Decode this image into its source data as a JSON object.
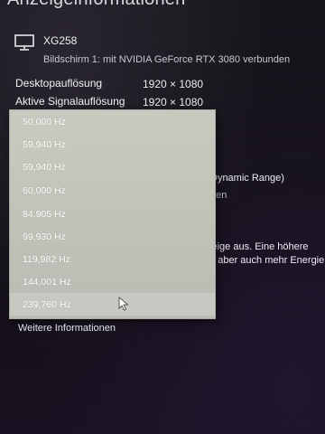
{
  "page": {
    "title": "Anzeigeinformationen"
  },
  "monitor": {
    "name": "XG258",
    "connection": "Bildschirm 1: mit NVIDIA GeForce RTX 3080 verbunden",
    "icon": "monitor-icon"
  },
  "info": [
    {
      "label": "Desktopauflösung",
      "value": "1920 × 1080"
    },
    {
      "label": "Aktive Signalauflösung",
      "value": "1920 × 1080"
    }
  ],
  "obscured_text": {
    "dynamic_range": "Dynamic Range)",
    "fragment_gen": "gen",
    "refresh_note_1": "zeige aus. Eine höhere",
    "refresh_note_2": "gt aber auch mehr Energie."
  },
  "refresh_dropdown": {
    "options": [
      "50,000 Hz",
      "59,940 Hz",
      "59,940 Hz",
      "60,000 Hz",
      "84,905 Hz",
      "99,930 Hz",
      "119,982 Hz",
      "144,001 Hz",
      "239,760 Hz"
    ],
    "selected_index": 8
  },
  "links": {
    "more_info": "Weitere Informationen"
  }
}
